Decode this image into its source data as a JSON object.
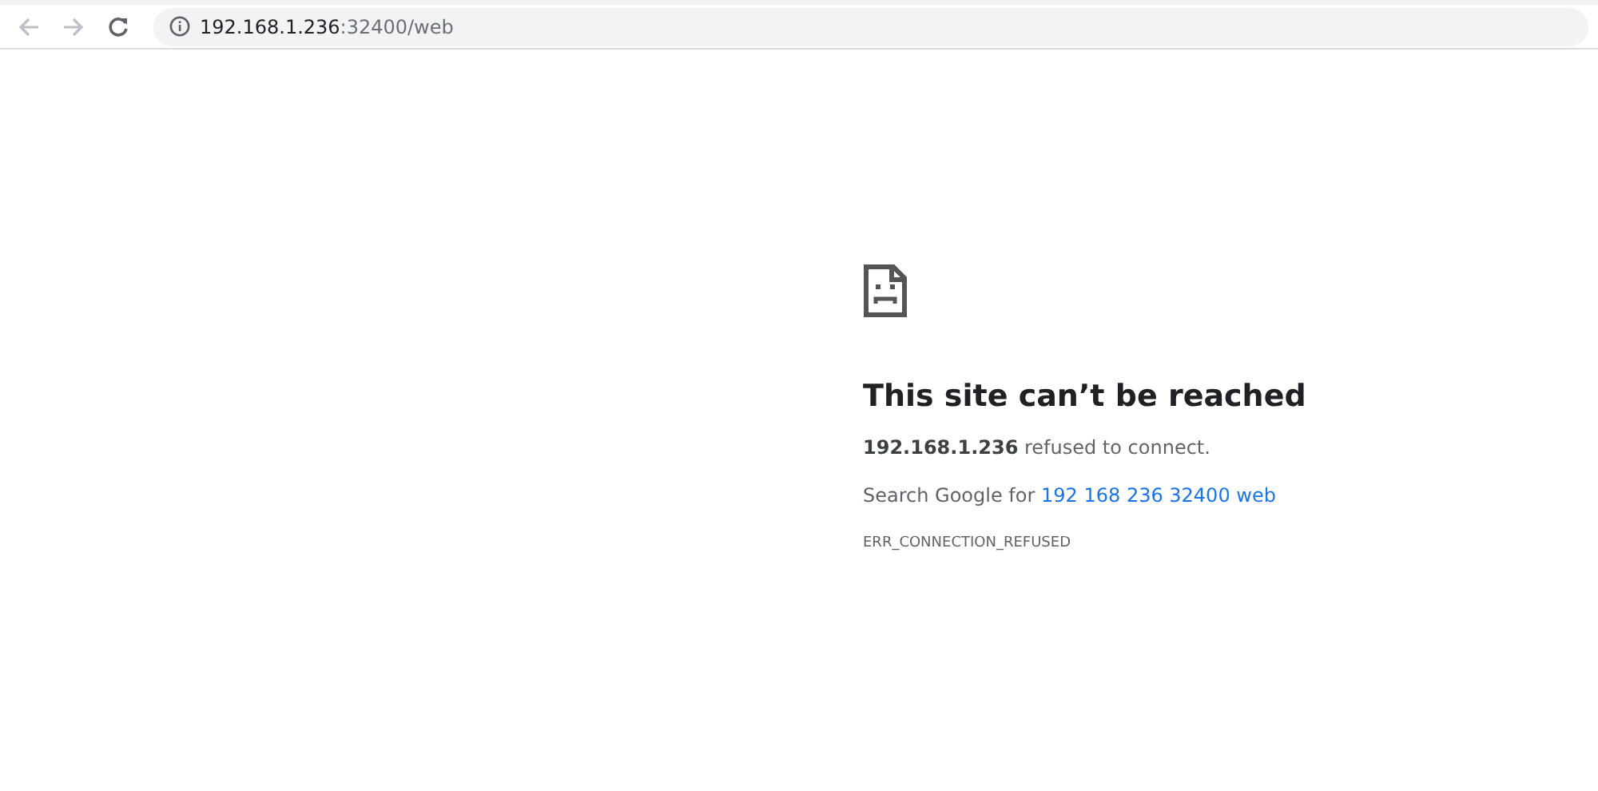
{
  "toolbar": {
    "back": {
      "disabled": true
    },
    "forward": {
      "disabled": true
    },
    "reload": {
      "disabled": false
    }
  },
  "address_bar": {
    "host": "192.168.1.236",
    "path": ":32400/web"
  },
  "error": {
    "title": "This site can’t be reached",
    "message": "**192.168.1.236** refused to connect.",
    "suggestion": "Search Google for ",
    "suggestion_link": "192 168 236 32400 web",
    "code": "ERR_CONNECTION_REFUSED"
  }
}
